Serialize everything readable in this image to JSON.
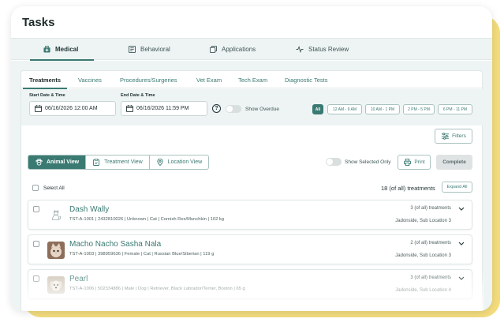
{
  "page": {
    "title": "Tasks"
  },
  "top_tabs": [
    {
      "label": "Medical",
      "icon": "medical-bag-icon",
      "active": true
    },
    {
      "label": "Behavioral",
      "icon": "behavioral-icon",
      "active": false
    },
    {
      "label": "Applications",
      "icon": "applications-icon",
      "active": false
    },
    {
      "label": "Status Review",
      "icon": "pulse-icon",
      "active": false
    }
  ],
  "sub_tabs": [
    {
      "label": "Treatments",
      "active": true
    },
    {
      "label": "Vaccines",
      "active": false
    },
    {
      "label": "Procedures/Surgeries",
      "active": false
    },
    {
      "label": "Vet Exam",
      "active": false
    },
    {
      "label": "Tech Exam",
      "active": false
    },
    {
      "label": "Diagnostic Tests",
      "active": false
    }
  ],
  "filters": {
    "start_label": "Start Date & Time",
    "start_value": "06/16/2026 12:00 AM",
    "end_label": "End Date & Time",
    "end_value": "06/16/2026 11:59 PM",
    "help_glyph": "?",
    "show_overdue": "Show Overdue",
    "time_chips": [
      "All",
      "12 AM - 9 AM",
      "10 AM - 1 PM",
      "2 PM - 5 PM",
      "6 PM - 11 PM"
    ],
    "filters_button": "Filters"
  },
  "views": [
    {
      "label": "Animal View",
      "icon": "paw-icon",
      "active": true
    },
    {
      "label": "Treatment View",
      "icon": "clipboard-icon",
      "active": false
    },
    {
      "label": "Location View",
      "icon": "location-pin-icon",
      "active": false
    }
  ],
  "actions": {
    "show_selected": "Show Selected Only",
    "print": "Print",
    "complete": "Complete",
    "select_all": "Select All",
    "count": "18 (of all) treatments",
    "expand_all": "Expand All"
  },
  "rows": [
    {
      "name": "Dash Wally",
      "details": "TST-A-1001 | 2432810026 | Unknown | Cat | Cornish Rex/Munchkin | 102 kg",
      "count": "3 (of all) treatments",
      "location": "Jadonside, Sub Location 3",
      "avatar": "cat-placeholder-icon"
    },
    {
      "name": "Macho Nacho Sasha Nala",
      "details": "TST-A-1003 | 398959636 | Female | Cat | Russian Blue/Siberian | 119 g",
      "count": "2 (of all) treatments",
      "location": "Jadonside, Sub Location 3",
      "avatar": "cat-photo"
    },
    {
      "name": "Pearl",
      "details": "TST-A-1006 | 502334886 | Male | Dog | Retriever, Black Labrador/Terrier, Boston | 65 g",
      "count": "3 (of all) treatments",
      "location": "Jadonside, Sub Location 4",
      "avatar": "dog-photo"
    }
  ],
  "colors": {
    "accent": "#3a7a72",
    "background": "#eef4f4",
    "glow": "#f4dc7e"
  }
}
